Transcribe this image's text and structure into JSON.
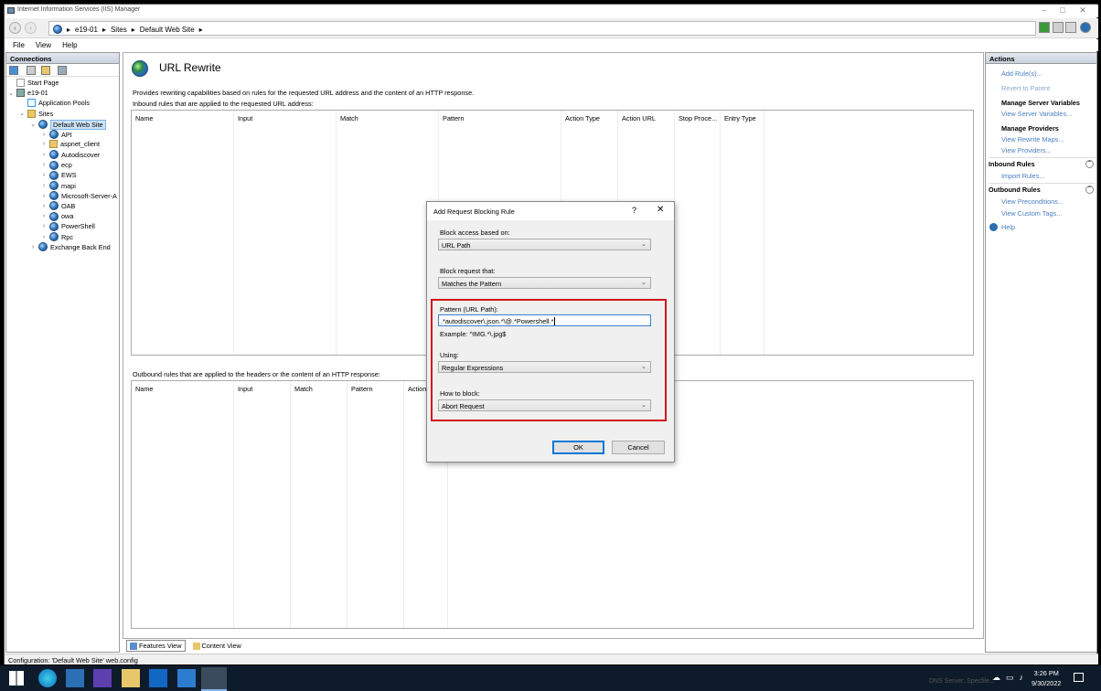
{
  "window": {
    "title": "Internet Information Services (IIS) Manager"
  },
  "address": {
    "crumbs": [
      "e19-01",
      "Sites",
      "Default Web Site"
    ]
  },
  "menu": [
    "File",
    "View",
    "Help"
  ],
  "connections": {
    "header": "Connections",
    "tree": [
      {
        "label": "Start Page",
        "indent": 0,
        "icon": "start-page-icon"
      },
      {
        "label": "e19-01",
        "indent": 0,
        "icon": "server-icon"
      },
      {
        "label": "Application Pools",
        "indent": 1,
        "icon": "app-pools-icon"
      },
      {
        "label": "Sites",
        "indent": 1,
        "icon": "sites-folder-icon"
      },
      {
        "label": "Default Web Site",
        "indent": 2,
        "icon": "globe-icon",
        "selected": true
      },
      {
        "label": "API",
        "indent": 3,
        "icon": "globe-icon"
      },
      {
        "label": "aspnet_client",
        "indent": 3,
        "icon": "folder-icon"
      },
      {
        "label": "Autodiscover",
        "indent": 3,
        "icon": "globe-icon"
      },
      {
        "label": "ecp",
        "indent": 3,
        "icon": "globe-icon"
      },
      {
        "label": "EWS",
        "indent": 3,
        "icon": "globe-icon"
      },
      {
        "label": "mapi",
        "indent": 3,
        "icon": "globe-icon"
      },
      {
        "label": "Microsoft-Server-A",
        "indent": 3,
        "icon": "globe-icon"
      },
      {
        "label": "OAB",
        "indent": 3,
        "icon": "globe-icon"
      },
      {
        "label": "owa",
        "indent": 3,
        "icon": "globe-icon"
      },
      {
        "label": "PowerShell",
        "indent": 3,
        "icon": "globe-icon"
      },
      {
        "label": "Rpc",
        "indent": 3,
        "icon": "globe-icon"
      },
      {
        "label": "Exchange Back End",
        "indent": 2,
        "icon": "globe-icon"
      }
    ]
  },
  "main": {
    "title": "URL Rewrite",
    "description": "Provides rewriting capabilities based on rules for the requested URL address and the content of an HTTP response.",
    "inbound_caption": "Inbound rules that are applied to the requested URL address:",
    "inbound_columns": [
      "Name",
      "Input",
      "Match",
      "Pattern",
      "Action Type",
      "Action URL",
      "Stop Proce...",
      "Entry Type"
    ],
    "outbound_caption": "Outbound rules that are applied to the headers or the content of an HTTP response:",
    "outbound_columns": [
      "Name",
      "Input",
      "Match",
      "Pattern",
      "Action"
    ]
  },
  "tabs": {
    "features": "Features View",
    "content": "Content View"
  },
  "actions": {
    "header": "Actions",
    "add_rule": "Add Rule(s)...",
    "revert": "Revert to Parent",
    "manage_server_vars": "Manage Server Variables",
    "view_server_vars": "View Server Variables...",
    "manage_providers": "Manage Providers",
    "view_rewrite_maps": "View Rewrite Maps...",
    "view_providers": "View Providers...",
    "inbound_rules": "Inbound Rules",
    "import_rules": "Import Rules...",
    "outbound_rules": "Outbound Rules",
    "view_preconditions": "View Preconditions...",
    "view_custom_tags": "View Custom Tags...",
    "help": "Help"
  },
  "status": {
    "text": "Configuration: 'Default Web Site' web.config"
  },
  "dialog": {
    "title": "Add Request Blocking Rule",
    "help_glyph": "?",
    "block_access_label": "Block access based on:",
    "block_access_value": "URL Path",
    "block_request_label": "Block request that:",
    "block_request_value": "Matches the Pattern",
    "pattern_label": "Pattern (URL Path):",
    "pattern_value": ".*autodiscover\\.json.*\\@.*Powershell.*",
    "example": "Example: ^IMG.*\\.jpg$",
    "using_label": "Using:",
    "using_value": "Regular Expressions",
    "how_label": "How to block:",
    "how_value": "Abort Request",
    "ok": "OK",
    "cancel": "Cancel"
  },
  "taskbar": {
    "time": "3:26 PM",
    "date": "9/30/2022",
    "watermark": "DNS Server: Specfile..."
  }
}
